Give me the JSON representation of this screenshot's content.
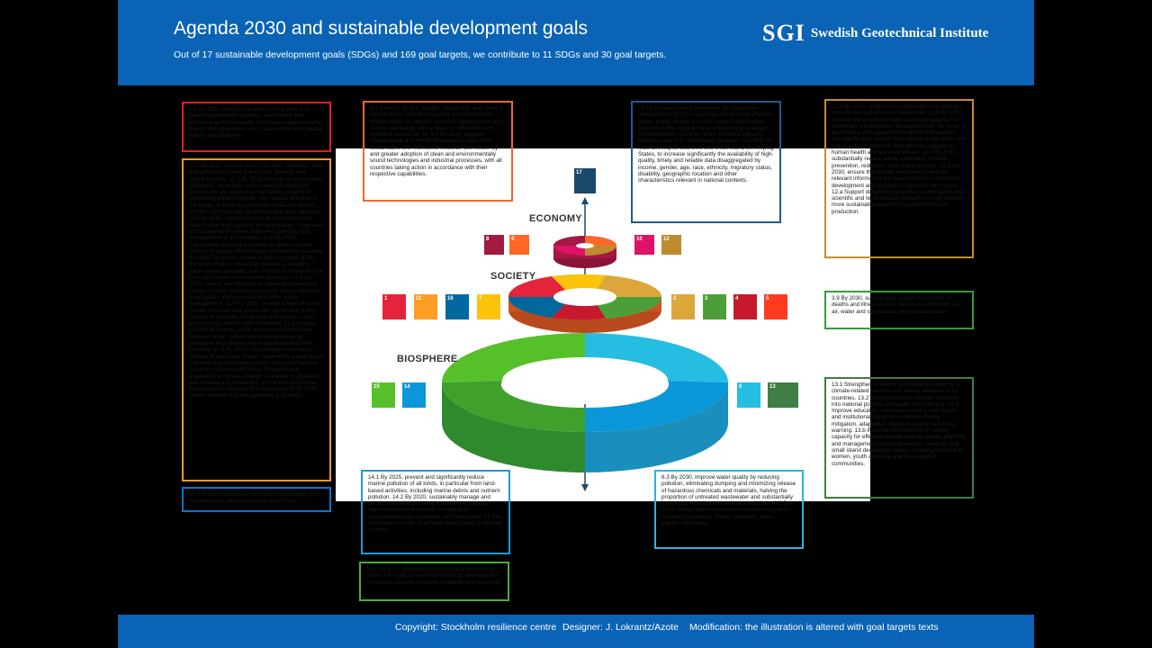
{
  "header": {
    "title": "Agenda 2030 and sustainable development goals",
    "subtitle": "Out of 17 sustainable development goals (SDGs) and 169 goal targets, we contribute to 11 SDGs and 30 goal targets.",
    "logo_mark": "SGI",
    "logo_name": "Swedish Geotechnical Institute"
  },
  "footer": {
    "copyright": "Copyright: Stockholm resilience centre",
    "designer": "Designer: J. Lokrantz/Azote",
    "modification": "Modification: the illustration is altered with goal targets texts"
  },
  "diagram": {
    "economy_label": "ECONOMY",
    "society_label": "SOCIETY",
    "biosphere_label": "BIOSPHERE"
  },
  "targets": {
    "t1_5": "1.5 By 2030, build the resilience of the poor and those in vulnerable situations and reduce their exposure and vulnerability to climate-related extreme events and other economic, social and environmental shocks and disasters.",
    "t11": "11.1 By 2030, ensure access for all to adequate, safe and affordable housing and basic services and upgrade slums. 11.2 By 2030, provide access to safe, affordable, accessible and sustainable transport systems for all, improving road safety, notably by expanding public transport, with special attention to the needs of those in vulnerable situations, women, children, persons with disabilities and older persons. 11.3 By 2030, enhance inclusive and sustainable urbanization and capacity for participatory, integrated and sustainable human settlement planning and management in all countries. 11.5 By 2030, significantly reduce the number of deaths and the number of people affected and substantially decrease the direct economic losses relative to global gross domestic product caused by disasters, including water-related disasters, with a focus on protecting the poor and people in vulnerable situations. 11.6 By 2030, reduce the adverse per capita environmental impact of cities, including by paying special attention to air quality and municipal and other waste management. 11.7 By 2030, provide universal access to safe, inclusive and accessible, green and public spaces, in particular for women and children, older persons and persons with disabilities. 11.a Support positive economic, social and environmental links between urban, peri-urban and rural areas by strengthening national and regional development planning. 11.b By 2020, substantially increase the number of cities and human settlements adopting and implementing integrated policies and plans towards inclusion, resource efficiency, mitigation and adaptation to climate change, resilience to disasters, and develop and implement, in line with the Sendai Framework for Disaster Risk Reduction 2015-2030, holistic disaster risk management at all levels.",
    "t16_7": "16.7 Ensure responsive, inclusive, participatory and representative decision-making at all levels.",
    "t9": "9.1 Develop quality, reliable, sustainable and resilient infrastructure, including regional and transborder infrastructure, to support economic development and human well-being, with a focus on affordable and equitable access for all. 9.4 By 2030, upgrade infrastructure and retrofit industries to make them sustainable, with increased resource-use efficiency and greater adoption of clean and environmentally sound technologies and industrial processes, with all countries taking action in accordance with their respective capabilities.",
    "t17": "17.14 Enhance policy coherence for sustainable development. 17.17 Encourage and promote effective public, public-private and civil society partnerships, building on the experience and resourcing strategies of partnerships. 17.18 By 2020, enhance capacity-building support to developing countries, including for least developed countries and small island developing States, to increase significantly the availability of high-quality, timely and reliable data disaggregated by income, gender, age, race, ethnicity, migratory status, disability, geographic location and other characteristics relevant in national contexts.",
    "t12": "12.2 By 2030, achieve the sustainable management and efficient use of natural resources. 12.4 By 2020, achieve the environmentally sound management of chemicals and all wastes throughout their life cycle, in accordance with agreed international frameworks, and significantly reduce their release to air, water and soil in order to minimize their adverse impacts on human health and the environment. 12.5 By 2030, substantially reduce waste generation through prevention, reduction, recycling and reuse. 12.8 By 2030, ensure that people everywhere have the relevant information and awareness for sustainable development and lifestyles in harmony with nature. 12.a Support developing countries to strengthen their scientific and technological capacity to move towards more sustainable patterns of consumption and production.",
    "t3_9": "3.9 By 2030, substantially reduce the number of deaths and illnesses from hazardous chemicals and air, water and soil pollution and contamination.",
    "t13": "13.1 Strengthen resilience and adaptive capacity to climate-related hazards and natural disasters in all countries. 13.2 Integrate climate change measures into national policies, strategies and planning. 13.3 Improve education, awareness-raising and human and institutional capacity on climate change mitigation, adaptation, impact reduction and early warning. 13.b Promote mechanisms for raising capacity for effective climate change-related planning and management in least developed countries and small island developing States, including focusing on women, youth and local and marginalized communities.",
    "t14": "14.1 By 2025, prevent and significantly reduce marine pollution of all kinds, in particular from land-based activities, including marine debris and nutrient pollution. 14.2 By 2020, sustainably manage and protect marine and coastal ecosystems to avoid significant adverse impacts, including by strengthening their resilience, and take action for their restoration in order to achieve healthy and productive oceans.",
    "t15_9": "15.9 By 2020, integrate ecosystem and biodiversity values into national and local planning, development processes, poverty reduction strategies and accounts.",
    "t6": "6.3 By 2030, improve water quality by reducing pollution, eliminating dumping and minimizing release of hazardous chemicals and materials, halving the proportion of untreated wastewater and substantially increasing recycling and safe reuse globally. 6.6 By 2020, protect and restore water-related ecosystems, including mountains, forests, wetlands, rivers, aquifers and lakes."
  },
  "sdg_tiles": [
    {
      "num": "17",
      "color": "#19486a"
    },
    {
      "num": "8",
      "color": "#a21942"
    },
    {
      "num": "9",
      "color": "#fd6925"
    },
    {
      "num": "10",
      "color": "#dd1367"
    },
    {
      "num": "12",
      "color": "#bf8b2e"
    },
    {
      "num": "1",
      "color": "#e5243b"
    },
    {
      "num": "11",
      "color": "#fd9d24"
    },
    {
      "num": "16",
      "color": "#00689d"
    },
    {
      "num": "7",
      "color": "#fcc30b"
    },
    {
      "num": "2",
      "color": "#dda63a"
    },
    {
      "num": "3",
      "color": "#4c9f38"
    },
    {
      "num": "4",
      "color": "#c5192d"
    },
    {
      "num": "5",
      "color": "#ff3a21"
    },
    {
      "num": "15",
      "color": "#56c02b"
    },
    {
      "num": "14",
      "color": "#0a97d9"
    },
    {
      "num": "6",
      "color": "#26bde2"
    },
    {
      "num": "13",
      "color": "#3f7e44"
    }
  ]
}
